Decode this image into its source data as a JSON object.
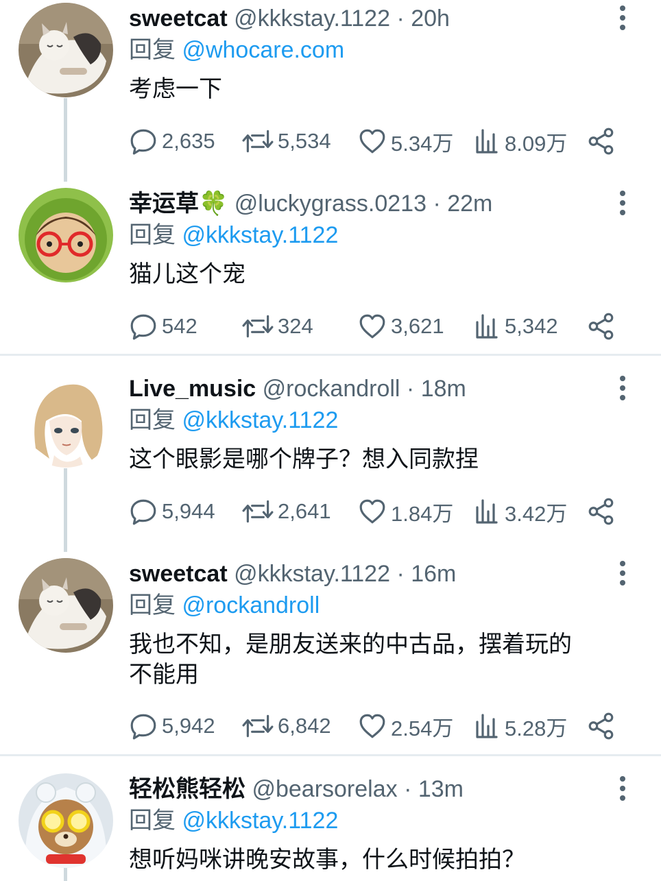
{
  "tweets": [
    {
      "name": "sweetcat",
      "handle": "@kkkstay.1122",
      "time": "20h",
      "reply_prefix": "回复",
      "reply_to": "@whocare.com",
      "text": "考虑一下",
      "replies": "2,635",
      "retweets": "5,534",
      "likes": "5.34万",
      "views": "8.09万",
      "avatar": "cat-avatar"
    },
    {
      "name": "幸运草",
      "name_emoji": "🍀",
      "handle": "@luckygrass.0213",
      "time": "22m",
      "reply_prefix": "回复",
      "reply_to": "@kkkstay.1122",
      "text": "猫儿这个宠",
      "replies": "542",
      "retweets": "324",
      "likes": "3,621",
      "views": "5,342",
      "avatar": "glasses-frog-avatar"
    },
    {
      "name": "Live_music",
      "handle": "@rockandroll",
      "time": "18m",
      "reply_prefix": "回复",
      "reply_to": "@kkkstay.1122",
      "text": "这个眼影是哪个牌子？想入同款捏",
      "replies": "5,944",
      "retweets": "2,641",
      "likes": "1.84万",
      "views": "3.42万",
      "avatar": "anime-girl-avatar"
    },
    {
      "name": "sweetcat",
      "handle": "@kkkstay.1122",
      "time": "16m",
      "reply_prefix": "回复",
      "reply_to": "@rockandroll",
      "text_line1": "我也不知，是朋友送来的中古品，摆着玩的",
      "text_line2": "不能用",
      "replies": "5,942",
      "retweets": "6,842",
      "likes": "2.54万",
      "views": "5.28万",
      "avatar": "cat-avatar"
    },
    {
      "name": "轻松熊轻松",
      "handle": "@bearsorelax",
      "time": "13m",
      "reply_prefix": "回复",
      "reply_to": "@kkkstay.1122",
      "text": "想听妈咪讲晚安故事，什么时候拍拍？",
      "avatar": "bear-avatar"
    }
  ],
  "separator": " · ",
  "colors": {
    "link": "#1d9bf0",
    "muted": "#536471",
    "text": "#0f1419",
    "thread_line": "#cfd9de"
  }
}
